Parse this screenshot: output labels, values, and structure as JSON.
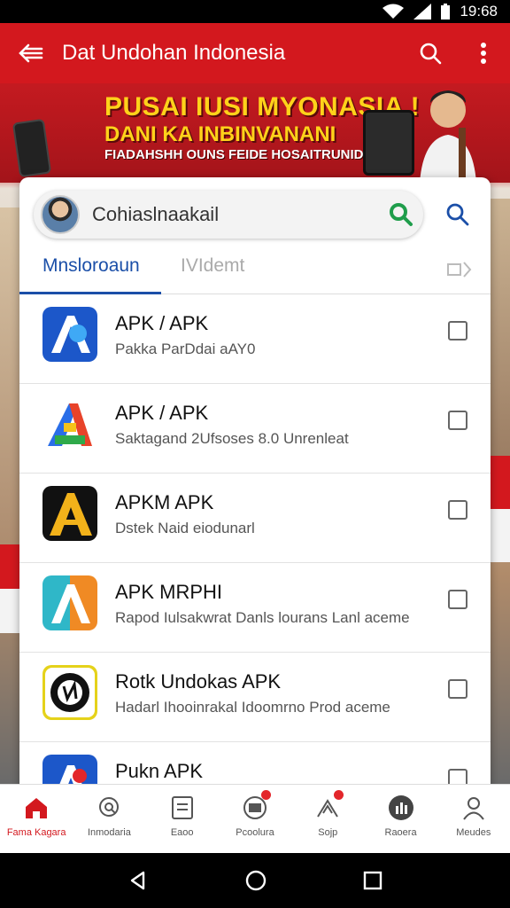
{
  "status_bar": {
    "time": "19:68"
  },
  "app_bar": {
    "title": "Dat Undohan Indonesia"
  },
  "banner": {
    "line1": "PUSAI IUSI MYONASIA !",
    "line2": "DANI KA INBINVANANI",
    "line3": "FIADAHSHH OUNS FEIDE HOSAITRUNIDSON"
  },
  "search": {
    "text": "Cohiaslnaakail"
  },
  "tabs": [
    {
      "label": "Mnsloroaun"
    },
    {
      "label": "IVIdemt"
    }
  ],
  "apps": [
    {
      "name": "APK / APK",
      "subtitle": "Pakka ParDdai aAY0"
    },
    {
      "name": "APK / APK",
      "subtitle": "Saktagand 2Ufsoses 8.0 Unrenleat"
    },
    {
      "name": "APKM APK",
      "subtitle": "Dstek Naid eiodunarl"
    },
    {
      "name": "APK MRPHI",
      "subtitle": "Rapod Iulsakwrat Danls lourans Lanl aceme"
    },
    {
      "name": "Rotk Undokas APK",
      "subtitle": "Hadarl Ihooinrakal Idoomrno Prod aceme"
    },
    {
      "name": "Pukn APK",
      "subtitle": ""
    }
  ],
  "bottom_nav": [
    {
      "label": "Fama Kagara",
      "icon": "home-icon"
    },
    {
      "label": "Inmodaria",
      "icon": "search-chat-icon"
    },
    {
      "label": "Eaoo",
      "icon": "document-icon"
    },
    {
      "label": "Pcoolura",
      "icon": "inbox-icon"
    },
    {
      "label": "Sojp",
      "icon": "share-icon"
    },
    {
      "label": "Raoera",
      "icon": "grid-circle-icon"
    },
    {
      "label": "Meudes",
      "icon": "person-icon"
    }
  ],
  "colors": {
    "brand_red": "#d3181e",
    "accent_blue": "#1b4fa8"
  }
}
